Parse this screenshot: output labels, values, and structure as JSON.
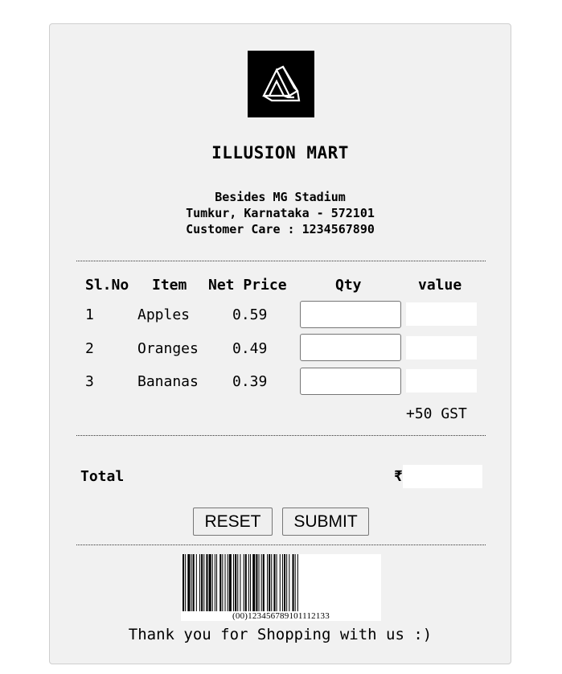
{
  "store": {
    "logo_icon": "impossible-triangle-logo-icon",
    "name": "ILLUSION MART",
    "address_line1": "Besides MG Stadium",
    "address_line2": "Tumkur, Karnataka - 572101",
    "customer_care": "Customer Care : 1234567890"
  },
  "table": {
    "headers": [
      "Sl.No",
      "Item",
      "Net Price",
      "Qty",
      "value"
    ],
    "rows": [
      {
        "sl": "1",
        "item": "Apples",
        "price": "0.59",
        "qty": "",
        "value": ""
      },
      {
        "sl": "2",
        "item": "Oranges",
        "price": "0.49",
        "qty": "",
        "value": ""
      },
      {
        "sl": "3",
        "item": "Bananas",
        "price": "0.39",
        "qty": "",
        "value": ""
      }
    ],
    "gst_note": "+50 GST"
  },
  "total": {
    "label": "Total",
    "currency": "₹",
    "value": ""
  },
  "buttons": {
    "reset": "RESET",
    "submit": "SUBMIT"
  },
  "barcode": {
    "text": "(00)123456789101112133"
  },
  "footer": {
    "thanks": "Thank you for Shopping with us :)"
  }
}
